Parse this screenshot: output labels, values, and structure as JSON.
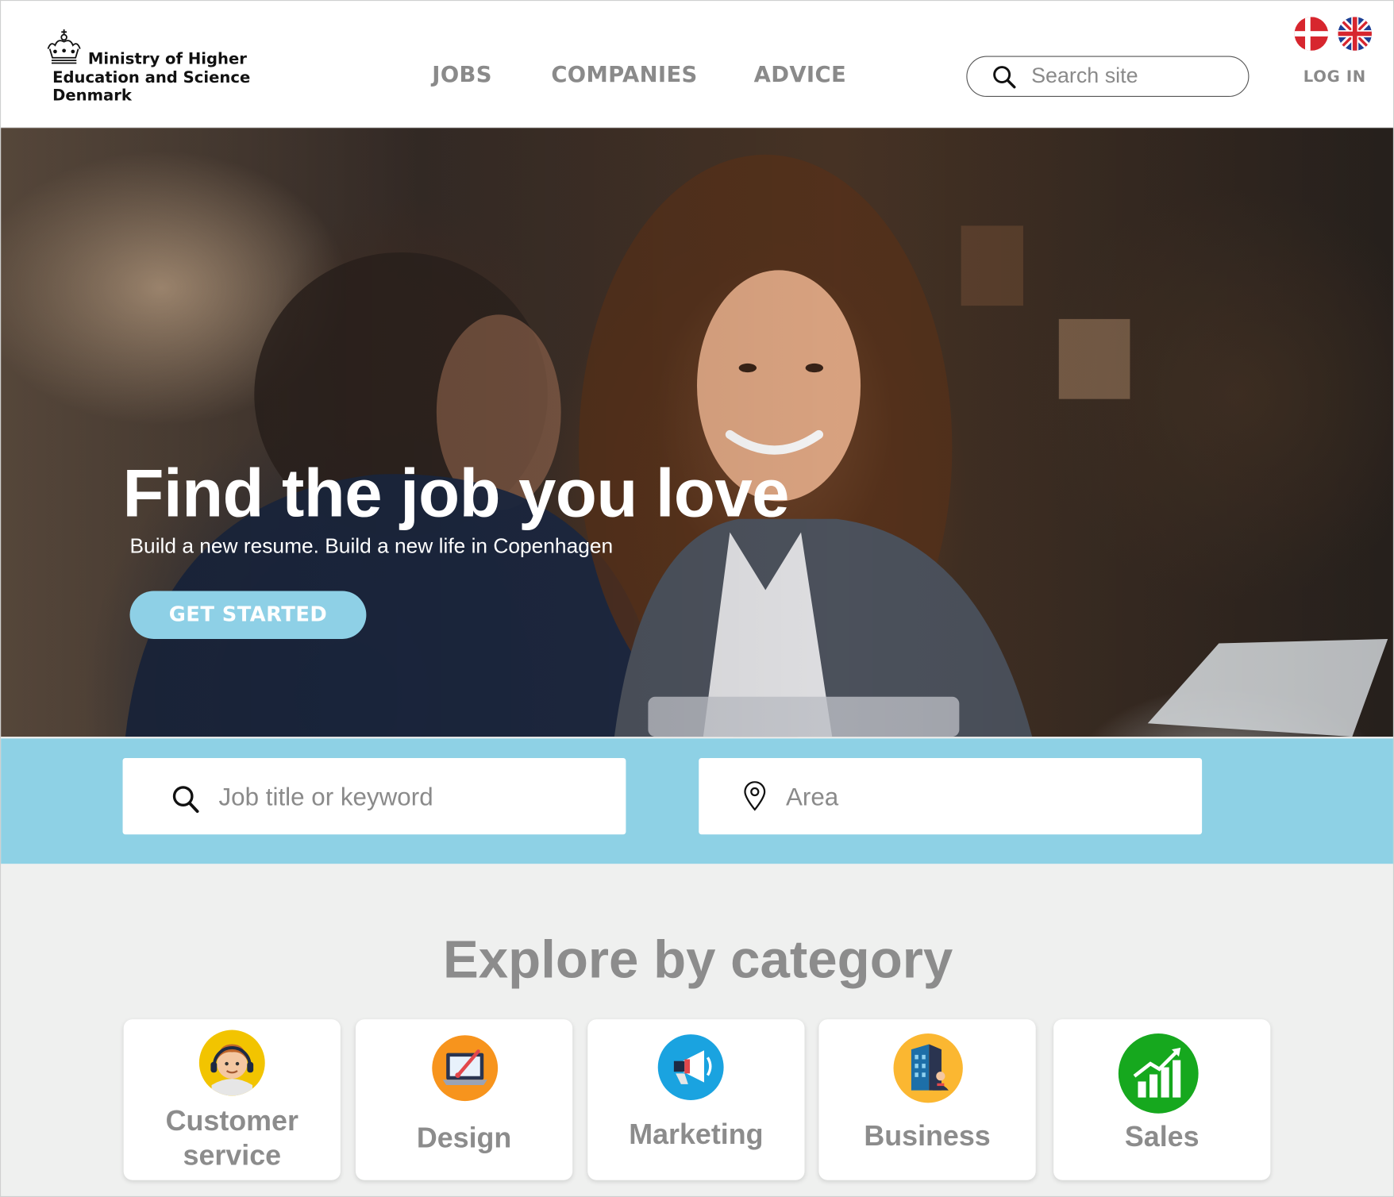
{
  "header": {
    "logo_lines": [
      "Ministry of Higher",
      "Education and Science",
      "Denmark"
    ],
    "nav": [
      {
        "label": "JOBS"
      },
      {
        "label": "COMPANIES"
      },
      {
        "label": "ADVICE"
      }
    ],
    "search_placeholder": "Search site",
    "login_label": "LOG IN",
    "languages": [
      "danish-flag-icon",
      "uk-flag-icon"
    ]
  },
  "hero": {
    "title": "Find the job you love",
    "subtitle": "Build a new resume. Build a new life in Copenhagen",
    "cta_label": "GET STARTED"
  },
  "search": {
    "keyword_placeholder": "Job title or keyword",
    "area_placeholder": "Area"
  },
  "categories": {
    "title": "Explore by category",
    "items": [
      {
        "label_lines": [
          "Customer",
          "service"
        ],
        "icon": "customer-service-icon",
        "color": "#f2c400"
      },
      {
        "label_lines": [
          "Design"
        ],
        "icon": "design-icon",
        "color": "#f7941d"
      },
      {
        "label_lines": [
          "Marketing"
        ],
        "icon": "marketing-icon",
        "color": "#1aa3e0"
      },
      {
        "label_lines": [
          "Business"
        ],
        "icon": "business-icon",
        "color": "#fbb731"
      },
      {
        "label_lines": [
          "Sales"
        ],
        "icon": "sales-icon",
        "color": "#16a81e"
      }
    ]
  },
  "colors": {
    "accent": "#8ed1e5",
    "nav_text": "#8a8a8a",
    "page_bg": "#eff0ef"
  }
}
